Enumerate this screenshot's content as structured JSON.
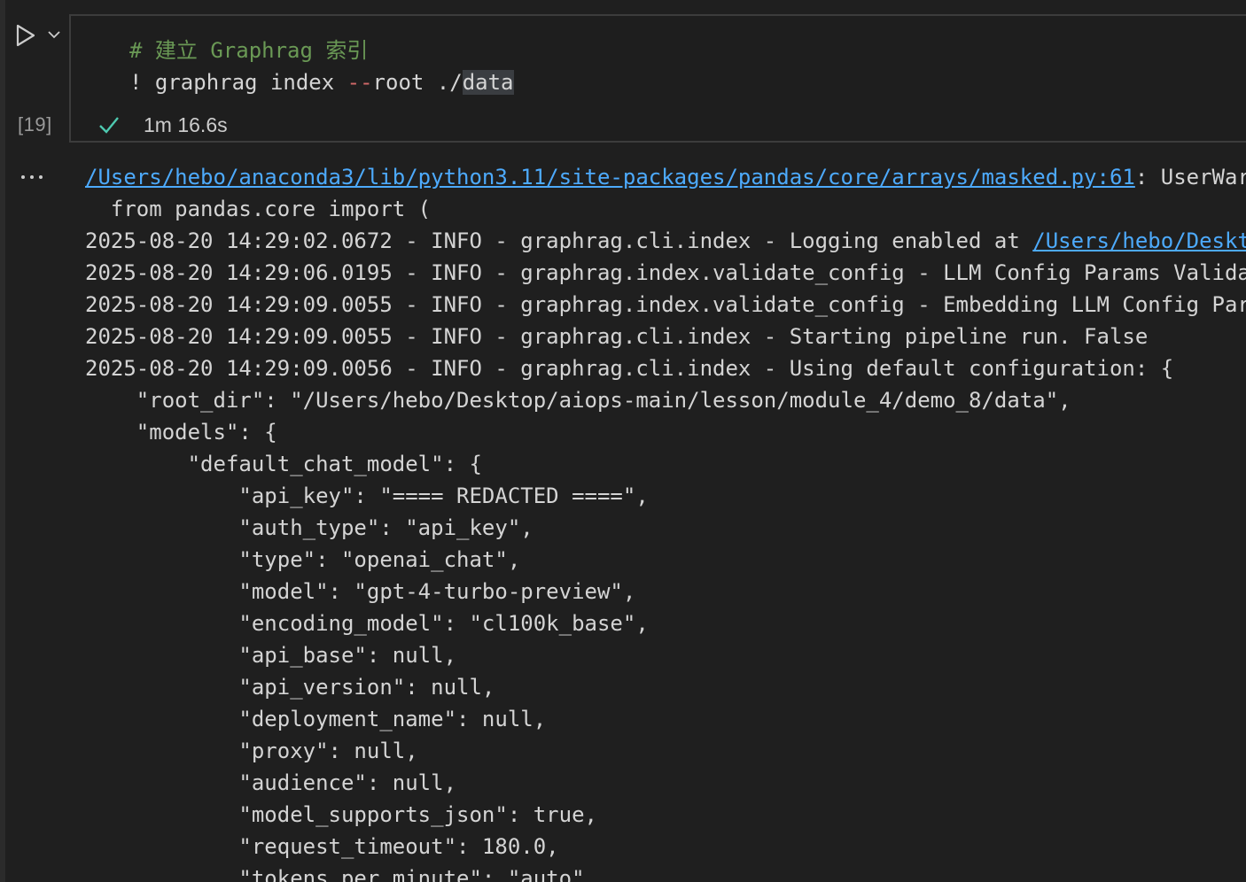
{
  "cell": {
    "execution_count": "[19]",
    "code_comment": "# 建立 Graphrag 索引",
    "code_cmd_prefix": "! graphrag index ",
    "code_cmd_flag": "--",
    "code_cmd_mid": "root ./",
    "code_cmd_highlight": "data",
    "status_icon": "check-icon",
    "duration": "1m 16.6s"
  },
  "colors": {
    "comment": "#6a9955",
    "link": "#4daafc",
    "success": "#4ec9b0",
    "operator": "#d16969"
  },
  "output": {
    "warning_path": "/Users/hebo/anaconda3/lib/python3.11/site-packages/pandas/core/arrays/masked.py:61",
    "warning_rest": ": UserWar",
    "line_import": "  from pandas.core import (",
    "line_log1_text": "2025-08-20 14:29:02.0672 - INFO - graphrag.cli.index - Logging enabled at ",
    "line_log1_link": "/Users/hebo/Deskt",
    "lines": [
      "2025-08-20 14:29:06.0195 - INFO - graphrag.index.validate_config - LLM Config Params Valida",
      "2025-08-20 14:29:09.0055 - INFO - graphrag.index.validate_config - Embedding LLM Config Par",
      "2025-08-20 14:29:09.0055 - INFO - graphrag.cli.index - Starting pipeline run. False",
      "2025-08-20 14:29:09.0056 - INFO - graphrag.cli.index - Using default configuration: {",
      "    \"root_dir\": \"/Users/hebo/Desktop/aiops-main/lesson/module_4/demo_8/data\",",
      "    \"models\": {",
      "        \"default_chat_model\": {",
      "            \"api_key\": \"==== REDACTED ====\",",
      "            \"auth_type\": \"api_key\",",
      "            \"type\": \"openai_chat\",",
      "            \"model\": \"gpt-4-turbo-preview\",",
      "            \"encoding_model\": \"cl100k_base\",",
      "            \"api_base\": null,",
      "            \"api_version\": null,",
      "            \"deployment_name\": null,",
      "            \"proxy\": null,",
      "            \"audience\": null,",
      "            \"model_supports_json\": true,",
      "            \"request_timeout\": 180.0,",
      "            \"tokens_per_minute\": \"auto\","
    ]
  }
}
